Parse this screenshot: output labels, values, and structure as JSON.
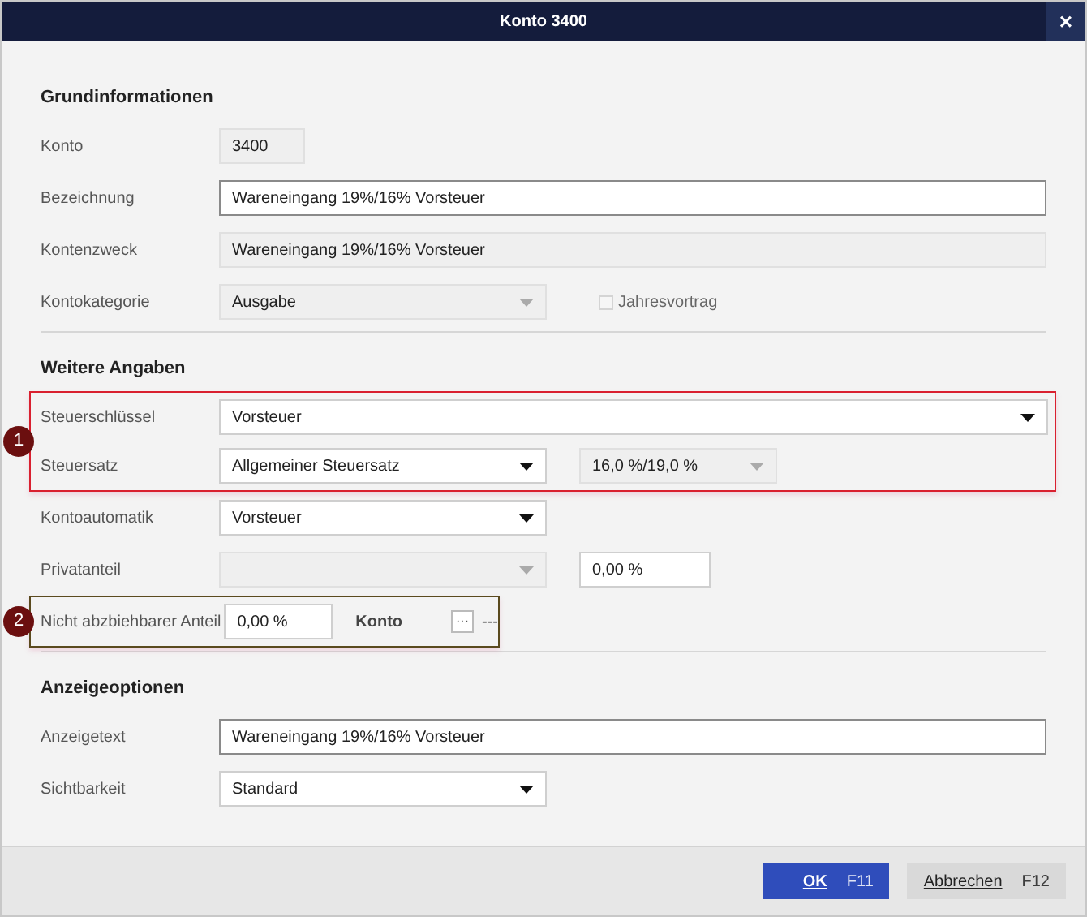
{
  "window": {
    "title": "Konto 3400",
    "close": "×"
  },
  "sections": [
    {
      "title": "Grundinformationen",
      "items": [
        {
          "kind": "row",
          "label": "Konto",
          "controls": [
            {
              "kind": "code-field",
              "value": "3400",
              "disabled": true
            }
          ]
        },
        {
          "kind": "row",
          "label": "Bezeichnung",
          "controls": [
            {
              "kind": "text-field",
              "value": "Wareneingang 19%/16% Vorsteuer",
              "disabled": false
            }
          ]
        },
        {
          "kind": "row",
          "label": "Kontenzweck",
          "controls": [
            {
              "kind": "text-field",
              "value": "Wareneingang 19%/16% Vorsteuer",
              "disabled": true
            }
          ]
        },
        {
          "kind": "row",
          "label": "Kontokategorie",
          "controls": [
            {
              "kind": "dropdown",
              "value": "Ausgabe",
              "disabled": true
            },
            {
              "kind": "checkbox",
              "label": "Jahresvortrag",
              "checked": false,
              "disabled": true
            }
          ]
        }
      ]
    },
    {
      "title": "Weitere Angaben",
      "items": [
        {
          "kind": "group",
          "callout": "1",
          "color": "#d9202f",
          "rows": [
            {
              "kind": "row",
              "label": "Steuerschlüssel",
              "controls": [
                {
                  "kind": "wide-dropdown",
                  "value": "Vorsteuer",
                  "disabled": false
                }
              ]
            },
            {
              "kind": "row",
              "label": "Steuersatz",
              "controls": [
                {
                  "kind": "dropdown",
                  "value": "Allgemeiner Steuersatz",
                  "disabled": false
                },
                {
                  "kind": "rate-dropdown",
                  "value": "16,0 %/19,0 %",
                  "disabled": true
                }
              ]
            }
          ]
        },
        {
          "kind": "row",
          "label": "Kontoautomatik",
          "controls": [
            {
              "kind": "dropdown",
              "value": "Vorsteuer",
              "disabled": false
            }
          ]
        },
        {
          "kind": "row",
          "label": "Privatanteil",
          "controls": [
            {
              "kind": "dropdown",
              "disabled": true
            },
            {
              "kind": "percent-field",
              "value": "0,00 %",
              "disabled": false
            }
          ]
        },
        {
          "kind": "group",
          "callout": "2",
          "color": "#5a4a1e",
          "rows": [
            {
              "kind": "row",
              "label": "Nicht abzbiehbarer Anteil",
              "controls": [
                {
                  "kind": "short-percent-field",
                  "value": "0,00 %",
                  "disabled": false
                },
                {
                  "kind": "caption",
                  "text": "Konto"
                },
                {
                  "kind": "dots-button",
                  "text": "···"
                },
                {
                  "kind": "text",
                  "text": "---"
                }
              ]
            }
          ]
        }
      ]
    },
    {
      "title": "Anzeigeoptionen",
      "items": [
        {
          "kind": "row",
          "label": "Anzeigetext",
          "controls": [
            {
              "kind": "text-field",
              "value": "Wareneingang 19%/16% Vorsteuer",
              "disabled": false
            }
          ]
        },
        {
          "kind": "row",
          "label": "Sichtbarkeit",
          "controls": [
            {
              "kind": "dropdown",
              "value": "Standard",
              "disabled": false
            }
          ]
        }
      ]
    }
  ],
  "buttons": [
    {
      "label": "OK",
      "shortcut": "F11",
      "primary": true
    },
    {
      "label": "Abbrechen",
      "shortcut": "F12",
      "primary": false
    }
  ]
}
